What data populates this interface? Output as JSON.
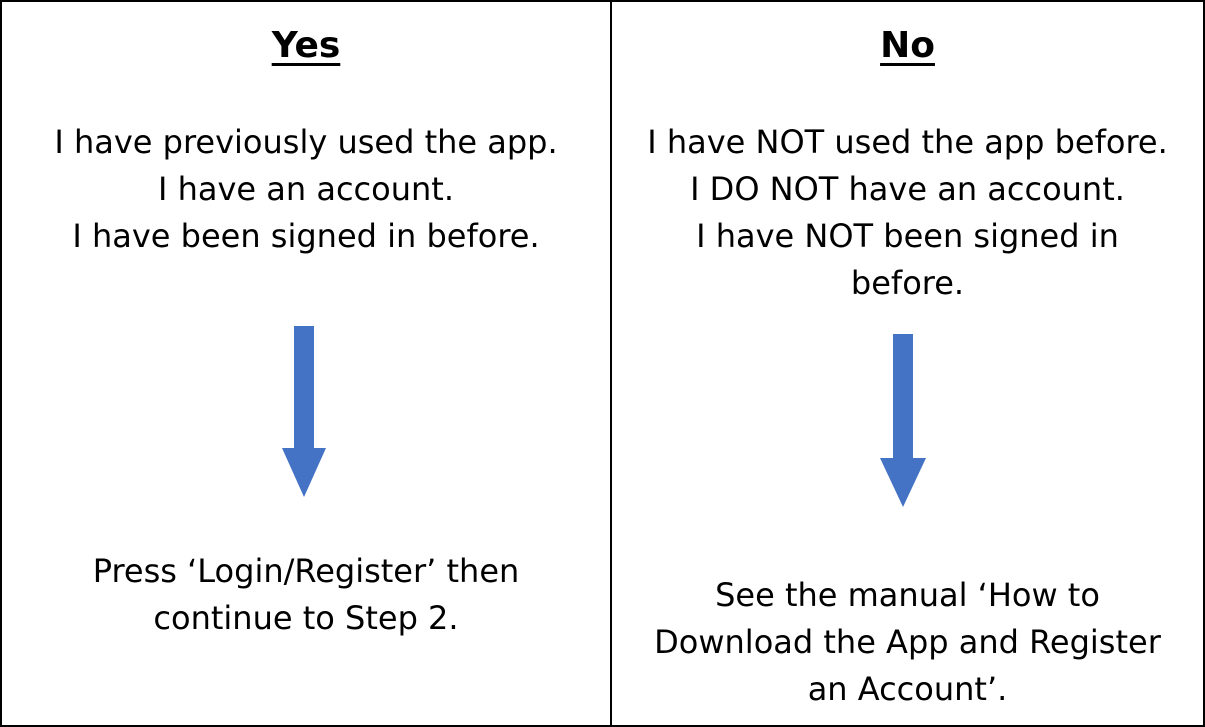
{
  "colors": {
    "arrow": "#4472C4",
    "border": "#000000",
    "text": "#000000"
  },
  "columns": [
    {
      "heading": "Yes",
      "condition_lines": [
        "I have previously used the app.",
        "I have an account.",
        "I have been signed in before."
      ],
      "arrow_icon": "arrow-down-icon",
      "action_lines": [
        "Press ‘Login/Register’ then",
        "continue to Step 2."
      ]
    },
    {
      "heading": "No",
      "condition_lines": [
        "I have NOT used the app before.",
        "I DO NOT have an account.",
        "I have NOT been signed in",
        "before."
      ],
      "arrow_icon": "arrow-down-icon",
      "action_lines": [
        "See the manual ‘How to",
        "Download the App and Register",
        "an Account’."
      ]
    }
  ]
}
